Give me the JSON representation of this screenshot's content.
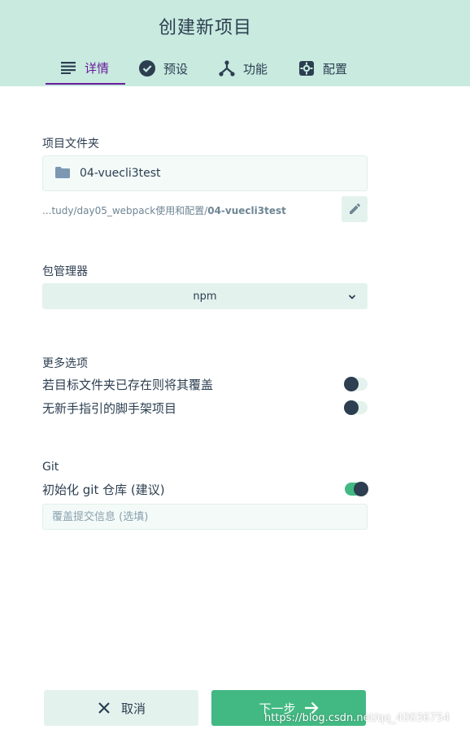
{
  "header": {
    "title": "创建新项目",
    "tabs": [
      {
        "label": "详情",
        "icon": "list-icon",
        "active": true
      },
      {
        "label": "预设",
        "icon": "check-circle-icon",
        "active": false
      },
      {
        "label": "功能",
        "icon": "fork-icon",
        "active": false
      },
      {
        "label": "配置",
        "icon": "gear-icon",
        "active": false
      }
    ]
  },
  "folder": {
    "label": "项目文件夹",
    "value": "04-vuecli3test",
    "path_prefix": "...tudy/day05_webpack使用和配置/",
    "path_bold": "04-vuecli3test"
  },
  "package_manager": {
    "label": "包管理器",
    "value": "npm"
  },
  "more_options": {
    "label": "更多选项",
    "overwrite": {
      "label": "若目标文件夹已存在则将其覆盖",
      "on": false
    },
    "no_guide": {
      "label": "无新手指引的脚手架项目",
      "on": false
    }
  },
  "git": {
    "label": "Git",
    "init": {
      "label": "初始化 git 仓库 (建议)",
      "on": true
    },
    "commit_placeholder": "覆盖提交信息 (选填)"
  },
  "footer": {
    "cancel_label": "取消",
    "next_label": "下一步"
  },
  "watermark": "https://blog.csdn.net/qq_40036754",
  "colors": {
    "header_bg": "#c8eadf",
    "active_tab": "#6a1b9a",
    "primary": "#42b983",
    "text": "#2c3e50"
  }
}
